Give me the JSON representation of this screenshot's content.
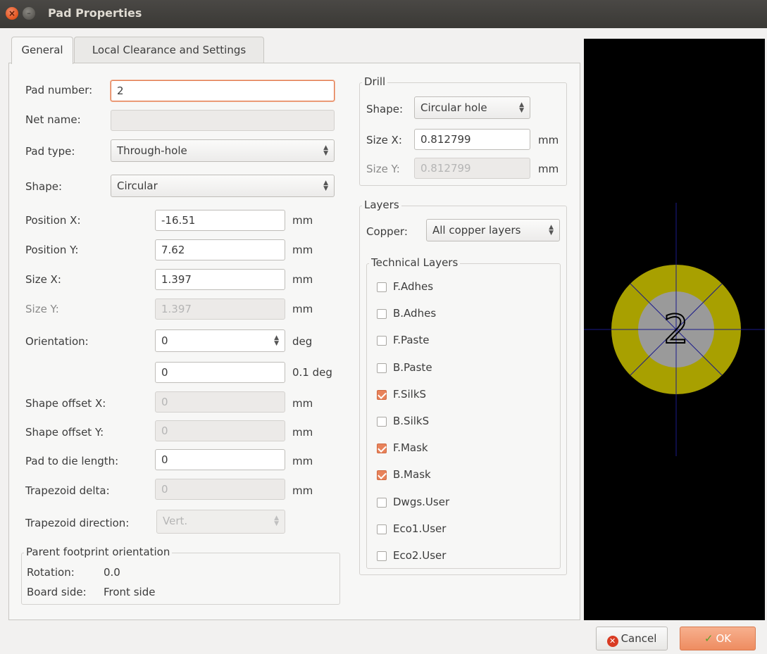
{
  "window": {
    "title": "Pad Properties"
  },
  "tabs": [
    "General",
    "Local Clearance and Settings"
  ],
  "general": {
    "pad_number": {
      "label": "Pad number:",
      "value": "2"
    },
    "net_name": {
      "label": "Net name:",
      "value": ""
    },
    "pad_type": {
      "label": "Pad type:",
      "value": "Through-hole"
    },
    "shape": {
      "label": "Shape:",
      "value": "Circular"
    },
    "position_x": {
      "label": "Position X:",
      "value": "-16.51",
      "unit": "mm"
    },
    "position_y": {
      "label": "Position Y:",
      "value": "7.62",
      "unit": "mm"
    },
    "size_x": {
      "label": "Size X:",
      "value": "1.397",
      "unit": "mm"
    },
    "size_y": {
      "label": "Size Y:",
      "value": "1.397",
      "unit": "mm"
    },
    "orientation": {
      "label": "Orientation:",
      "value": "0",
      "unit": "deg"
    },
    "orientation_fine": {
      "value": "0",
      "unit": "0.1 deg"
    },
    "shape_offset_x": {
      "label": "Shape offset X:",
      "value": "0",
      "unit": "mm"
    },
    "shape_offset_y": {
      "label": "Shape offset Y:",
      "value": "0",
      "unit": "mm"
    },
    "pad_to_die": {
      "label": "Pad to die length:",
      "value": "0",
      "unit": "mm"
    },
    "trapezoid_delta": {
      "label": "Trapezoid delta:",
      "value": "0",
      "unit": "mm"
    },
    "trapezoid_direction": {
      "label": "Trapezoid direction:",
      "value": "Vert."
    },
    "parent": {
      "title": "Parent footprint orientation",
      "rotation_label": "Rotation:",
      "rotation_value": "0.0",
      "side_label": "Board side:",
      "side_value": "Front side"
    }
  },
  "drill": {
    "title": "Drill",
    "shape": {
      "label": "Shape:",
      "value": "Circular hole"
    },
    "size_x": {
      "label": "Size X:",
      "value": "0.812799",
      "unit": "mm"
    },
    "size_y": {
      "label": "Size Y:",
      "value": "0.812799",
      "unit": "mm"
    }
  },
  "layers": {
    "title": "Layers",
    "copper": {
      "label": "Copper:",
      "value": "All copper layers"
    },
    "technical_title": "Technical Layers",
    "technical": [
      {
        "name": "F.Adhes",
        "checked": false
      },
      {
        "name": "B.Adhes",
        "checked": false
      },
      {
        "name": "F.Paste",
        "checked": false
      },
      {
        "name": "B.Paste",
        "checked": false
      },
      {
        "name": "F.SilkS",
        "checked": true
      },
      {
        "name": "B.SilkS",
        "checked": false
      },
      {
        "name": "F.Mask",
        "checked": true
      },
      {
        "name": "B.Mask",
        "checked": true
      },
      {
        "name": "Dwgs.User",
        "checked": false
      },
      {
        "name": "Eco1.User",
        "checked": false
      },
      {
        "name": "Eco2.User",
        "checked": false
      }
    ]
  },
  "preview": {
    "pad_label": "2",
    "pad_color": "#a8a000",
    "hole_color": "#9a9a9a",
    "axis_color": "#1a1a8a"
  },
  "buttons": {
    "cancel": "Cancel",
    "ok": "OK"
  }
}
